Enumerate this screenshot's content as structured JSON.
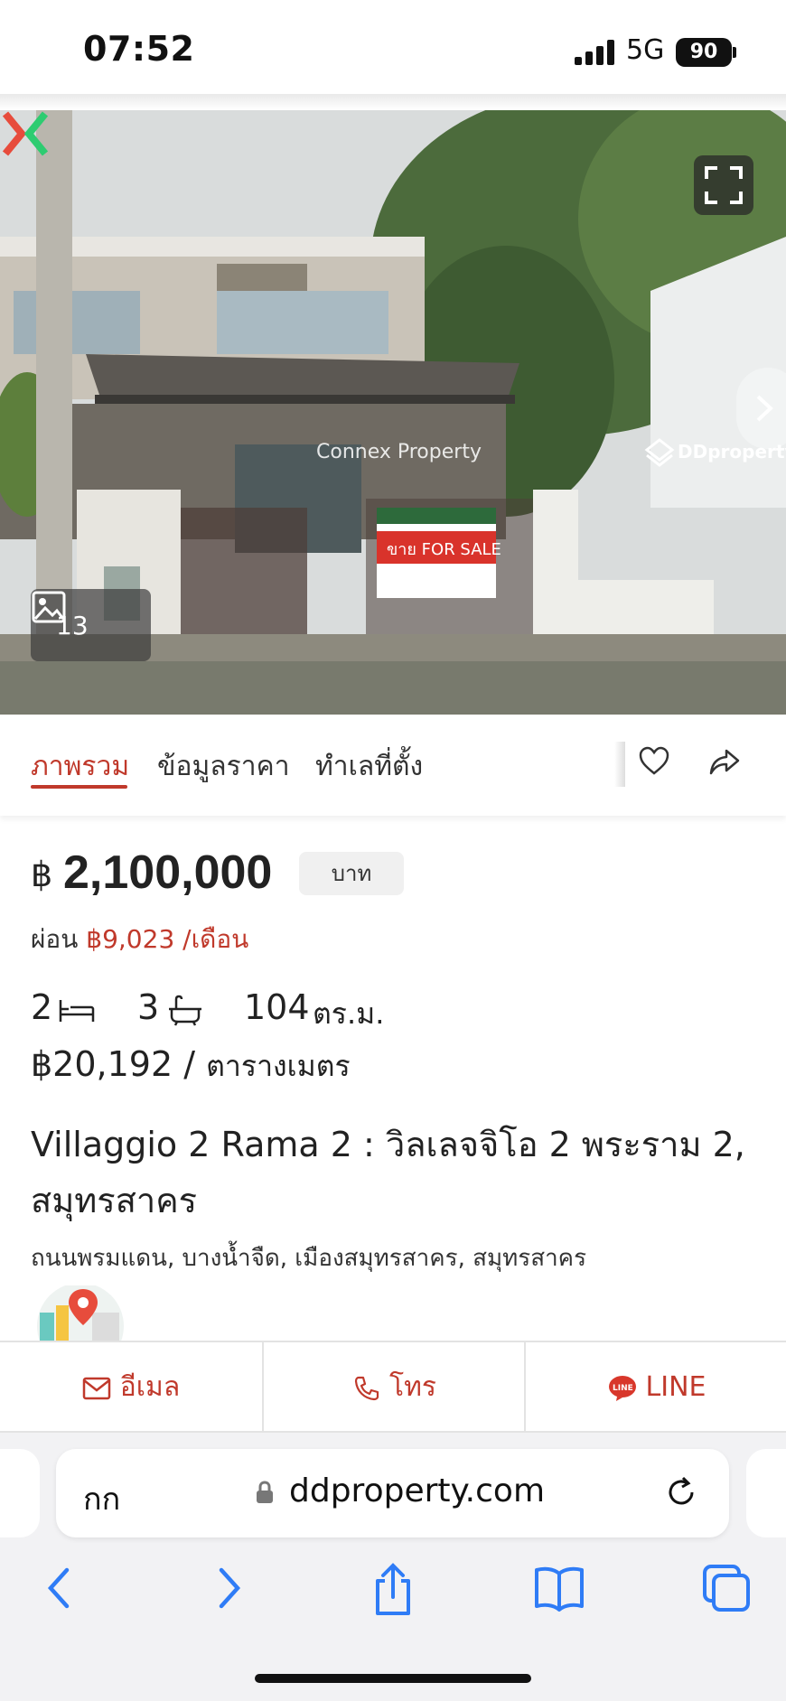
{
  "status_bar": {
    "time": "07:52",
    "network": "5G",
    "battery": "90"
  },
  "hero": {
    "photo_count": "13",
    "watermark": "Connex Property",
    "portal_logo": "DDproperty",
    "sign_text": "ขาย FOR SALE"
  },
  "tabs": [
    {
      "label": "ภาพรวม",
      "active": true
    },
    {
      "label": "ข้อมูลราคา",
      "active": false
    },
    {
      "label": "ทำเลที่ตั้ง",
      "active": false
    }
  ],
  "price": {
    "currency_symbol": "฿",
    "value": "2,100,000",
    "unit": "บาท",
    "installment_prefix": "ผ่อน",
    "installment_value": "฿9,023 /เดือน"
  },
  "specs": {
    "bedrooms": "2",
    "bathrooms": "3",
    "area": "104",
    "area_unit": "ตร.ม.",
    "price_per_sqm": "฿20,192 /",
    "price_per_sqm_unit": "ตารางเมตร"
  },
  "listing": {
    "title": "Villaggio 2 Rama 2 : วิลเลจจิโอ 2 พระราม 2, สมุทรสาคร",
    "address": "ถนนพรมแดน, บางน้ำจืด, เมืองสมุทรสาคร, สมุทรสาคร"
  },
  "contact": {
    "email_label": "อีเมล",
    "call_label": "โทร",
    "line_label": "LINE"
  },
  "browser": {
    "text_size_label": "กก",
    "url": "ddproperty.com"
  },
  "colors": {
    "accent": "#c0392b",
    "line_green_replaced_red": "#d8372b"
  }
}
